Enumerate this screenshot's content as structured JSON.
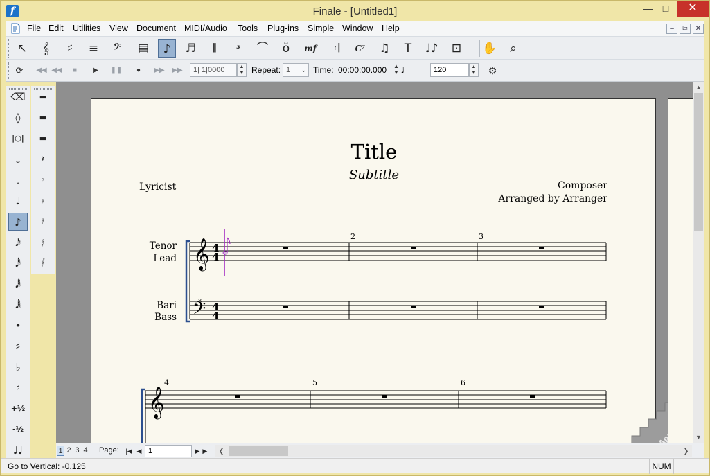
{
  "window": {
    "title": "Finale - [Untitled1]"
  },
  "menubar": {
    "items": [
      "File",
      "Edit",
      "Utilities",
      "View",
      "Document",
      "MIDI/Audio",
      "Tools",
      "Plug-ins",
      "Simple",
      "Window",
      "Help"
    ]
  },
  "toolbar1": {
    "tools": [
      {
        "name": "selection-tool",
        "glyph": "↖"
      },
      {
        "name": "staff-tool",
        "glyph": "𝄞"
      },
      {
        "name": "key-signature-tool",
        "glyph": "♯"
      },
      {
        "name": "time-signature-tool",
        "glyph": "≡"
      },
      {
        "name": "clef-tool",
        "glyph": "𝄢"
      },
      {
        "name": "measure-tool",
        "glyph": "▤"
      },
      {
        "name": "simple-entry-tool",
        "glyph": "♪"
      },
      {
        "name": "speedy-entry-tool",
        "glyph": "♬"
      },
      {
        "name": "hyperscribe-tool",
        "glyph": "𝄃"
      },
      {
        "name": "tuplet-tool",
        "glyph": "³"
      },
      {
        "name": "smart-shape-tool",
        "glyph": "⌒"
      },
      {
        "name": "articulation-tool",
        "glyph": "ŏ"
      },
      {
        "name": "expression-tool",
        "glyph": "mf"
      },
      {
        "name": "repeat-tool",
        "glyph": "𝄇"
      },
      {
        "name": "chord-tool",
        "glyph": "C⁷"
      },
      {
        "name": "lyrics-tool",
        "glyph": "♫"
      },
      {
        "name": "text-tool",
        "glyph": "T"
      },
      {
        "name": "resize-tool",
        "glyph": "♩♪"
      },
      {
        "name": "graphics-tool",
        "glyph": "⊡"
      },
      {
        "name": "hand-grabber-tool",
        "glyph": "✋"
      },
      {
        "name": "zoom-tool",
        "glyph": "⌕"
      }
    ],
    "selected_index": 6
  },
  "playback": {
    "counter": "1| 1|0000",
    "repeat_label": "Repeat:",
    "repeat_value": "1",
    "time_label": "Time:",
    "time_value": "00:00:00.000",
    "tempo_equals": "=",
    "tempo_value": "120"
  },
  "palette1": {
    "tools": [
      {
        "name": "eraser-icon",
        "glyph": "⌫"
      },
      {
        "name": "tie-icon",
        "glyph": "◊"
      },
      {
        "name": "cross-staff-icon",
        "glyph": "|○|"
      },
      {
        "name": "whole-note-icon",
        "glyph": "𝅝"
      },
      {
        "name": "half-note-icon",
        "glyph": "𝅗𝅥"
      },
      {
        "name": "quarter-note-icon",
        "glyph": "♩"
      },
      {
        "name": "eighth-note-icon",
        "glyph": "♪"
      },
      {
        "name": "sixteenth-note-icon",
        "glyph": "𝅘𝅥𝅯"
      },
      {
        "name": "thirty-second-note-icon",
        "glyph": "𝅘𝅥𝅰"
      },
      {
        "name": "sixty-fourth-note-icon",
        "glyph": "𝅘𝅥𝅱"
      },
      {
        "name": "one-twenty-eighth-note-icon",
        "glyph": "𝅘𝅥𝅲"
      },
      {
        "name": "dot-icon",
        "glyph": "•"
      },
      {
        "name": "sharp-icon",
        "glyph": "♯"
      },
      {
        "name": "flat-icon",
        "glyph": "♭"
      },
      {
        "name": "natural-icon",
        "glyph": "♮"
      },
      {
        "name": "half-step-up-icon",
        "glyph": "+½"
      },
      {
        "name": "half-step-down-icon",
        "glyph": "-½"
      },
      {
        "name": "grace-note-icon",
        "glyph": "♩♩"
      }
    ],
    "selected_index": 6
  },
  "palette2": {
    "tools": [
      {
        "name": "whole-rest-icon",
        "glyph": "▬"
      },
      {
        "name": "half-rest-icon",
        "glyph": "▬"
      },
      {
        "name": "half-rest-low-icon",
        "glyph": "▬"
      },
      {
        "name": "quarter-rest-icon",
        "glyph": "𝄽"
      },
      {
        "name": "eighth-rest-icon",
        "glyph": "𝄾"
      },
      {
        "name": "sixteenth-rest-icon",
        "glyph": "𝄿"
      },
      {
        "name": "thirty-second-rest-icon",
        "glyph": "𝅀"
      },
      {
        "name": "sixty-fourth-rest-icon",
        "glyph": "𝅁"
      },
      {
        "name": "one-twenty-eighth-rest-icon",
        "glyph": "𝅂"
      }
    ]
  },
  "score": {
    "title": "Title",
    "subtitle": "Subtitle",
    "lyricist": "Lyricist",
    "composer": "Composer",
    "arranger": "Arranged by Arranger",
    "staff1_name_line1": "Tenor",
    "staff1_name_line2": "Lead",
    "staff2_name_line1": "Bari",
    "staff2_name_line2": "Bass",
    "time_sig_top": "4",
    "time_sig_bottom": "4",
    "bass_octave_marker": "8",
    "measure_numbers_system1": [
      "2",
      "3"
    ],
    "measure_numbers_system2": [
      "4",
      "5",
      "6"
    ]
  },
  "bottombar": {
    "page_tabs": [
      "1",
      "2",
      "3",
      "4"
    ],
    "active_page_tab": "1",
    "page_label": "Page:",
    "page_value": "1"
  },
  "statusbar": {
    "text": "Go to Vertical: -0.125",
    "num": "NUM"
  },
  "colors": {
    "accent_selected": "#98b3d2",
    "window_frame": "#f0e6a8",
    "close_button": "#c7312a",
    "app_icon": "#1c72c9",
    "entry_cursor": "#a020c0",
    "bracket": "#2c4f8f"
  }
}
